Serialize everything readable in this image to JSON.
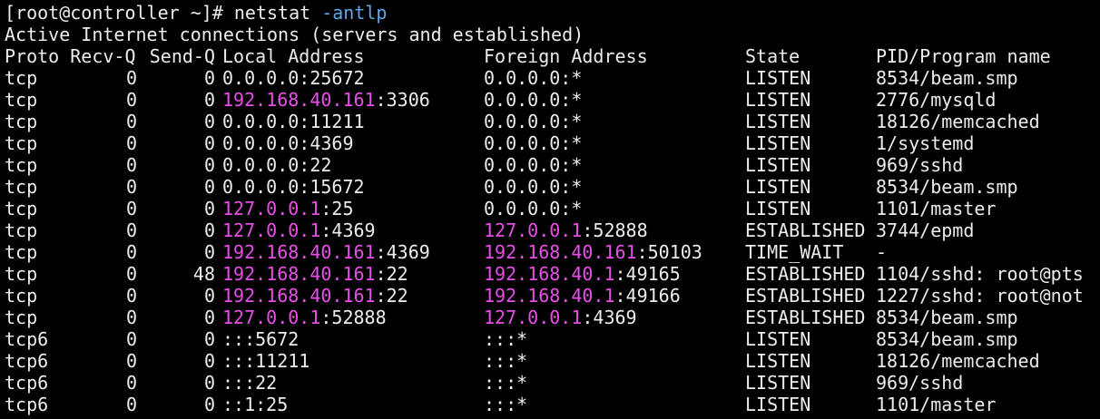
{
  "prompt": {
    "text": "[root@controller ~]# ",
    "command": "netstat ",
    "options": "-antlp"
  },
  "summary": "Active Internet connections (servers and established)",
  "headers": {
    "proto_recvq": "Proto Recv-Q",
    "sendq": "Send-Q",
    "local": "Local Address",
    "foreign": "Foreign Address",
    "state": "State",
    "pid": "PID/Program name"
  },
  "colors": {
    "background": "#000000",
    "text": "#ececec",
    "ip_highlight": "#e84fe8",
    "option_highlight": "#5fa8e8"
  },
  "rows": [
    {
      "proto": "tcp",
      "recvq": "0",
      "sendq": "0",
      "local_ip": "",
      "local_rest": "0.0.0.0:25672",
      "foreign_ip": "",
      "foreign_rest": "0.0.0.0:*",
      "state": "LISTEN",
      "pid": "8534/beam.smp"
    },
    {
      "proto": "tcp",
      "recvq": "0",
      "sendq": "0",
      "local_ip": "192.168.40.161",
      "local_rest": ":3306",
      "foreign_ip": "",
      "foreign_rest": "0.0.0.0:*",
      "state": "LISTEN",
      "pid": "2776/mysqld"
    },
    {
      "proto": "tcp",
      "recvq": "0",
      "sendq": "0",
      "local_ip": "",
      "local_rest": "0.0.0.0:11211",
      "foreign_ip": "",
      "foreign_rest": "0.0.0.0:*",
      "state": "LISTEN",
      "pid": "18126/memcached"
    },
    {
      "proto": "tcp",
      "recvq": "0",
      "sendq": "0",
      "local_ip": "",
      "local_rest": "0.0.0.0:4369",
      "foreign_ip": "",
      "foreign_rest": "0.0.0.0:*",
      "state": "LISTEN",
      "pid": "1/systemd"
    },
    {
      "proto": "tcp",
      "recvq": "0",
      "sendq": "0",
      "local_ip": "",
      "local_rest": "0.0.0.0:22",
      "foreign_ip": "",
      "foreign_rest": "0.0.0.0:*",
      "state": "LISTEN",
      "pid": "969/sshd"
    },
    {
      "proto": "tcp",
      "recvq": "0",
      "sendq": "0",
      "local_ip": "",
      "local_rest": "0.0.0.0:15672",
      "foreign_ip": "",
      "foreign_rest": "0.0.0.0:*",
      "state": "LISTEN",
      "pid": "8534/beam.smp"
    },
    {
      "proto": "tcp",
      "recvq": "0",
      "sendq": "0",
      "local_ip": "127.0.0.1",
      "local_rest": ":25",
      "foreign_ip": "",
      "foreign_rest": "0.0.0.0:*",
      "state": "LISTEN",
      "pid": "1101/master"
    },
    {
      "proto": "tcp",
      "recvq": "0",
      "sendq": "0",
      "local_ip": "127.0.0.1",
      "local_rest": ":4369",
      "foreign_ip": "127.0.0.1",
      "foreign_rest": ":52888",
      "state": "ESTABLISHED",
      "pid": "3744/epmd"
    },
    {
      "proto": "tcp",
      "recvq": "0",
      "sendq": "0",
      "local_ip": "192.168.40.161",
      "local_rest": ":4369",
      "foreign_ip": "192.168.40.161",
      "foreign_rest": ":50103",
      "state": "TIME_WAIT",
      "pid": "-"
    },
    {
      "proto": "tcp",
      "recvq": "0",
      "sendq": "48",
      "local_ip": "192.168.40.161",
      "local_rest": ":22",
      "foreign_ip": "192.168.40.1",
      "foreign_rest": ":49165",
      "state": "ESTABLISHED",
      "pid": "1104/sshd: root@pts"
    },
    {
      "proto": "tcp",
      "recvq": "0",
      "sendq": "0",
      "local_ip": "192.168.40.161",
      "local_rest": ":22",
      "foreign_ip": "192.168.40.1",
      "foreign_rest": ":49166",
      "state": "ESTABLISHED",
      "pid": "1227/sshd: root@not"
    },
    {
      "proto": "tcp",
      "recvq": "0",
      "sendq": "0",
      "local_ip": "127.0.0.1",
      "local_rest": ":52888",
      "foreign_ip": "127.0.0.1",
      "foreign_rest": ":4369",
      "state": "ESTABLISHED",
      "pid": "8534/beam.smp"
    },
    {
      "proto": "tcp6",
      "recvq": "0",
      "sendq": "0",
      "local_ip": "",
      "local_rest": ":::5672",
      "foreign_ip": "",
      "foreign_rest": ":::*",
      "state": "LISTEN",
      "pid": "8534/beam.smp"
    },
    {
      "proto": "tcp6",
      "recvq": "0",
      "sendq": "0",
      "local_ip": "",
      "local_rest": ":::11211",
      "foreign_ip": "",
      "foreign_rest": ":::*",
      "state": "LISTEN",
      "pid": "18126/memcached"
    },
    {
      "proto": "tcp6",
      "recvq": "0",
      "sendq": "0",
      "local_ip": "",
      "local_rest": ":::22",
      "foreign_ip": "",
      "foreign_rest": ":::*",
      "state": "LISTEN",
      "pid": "969/sshd"
    },
    {
      "proto": "tcp6",
      "recvq": "0",
      "sendq": "0",
      "local_ip": "",
      "local_rest": "::1:25",
      "foreign_ip": "",
      "foreign_rest": ":::*",
      "state": "LISTEN",
      "pid": "1101/master"
    }
  ]
}
